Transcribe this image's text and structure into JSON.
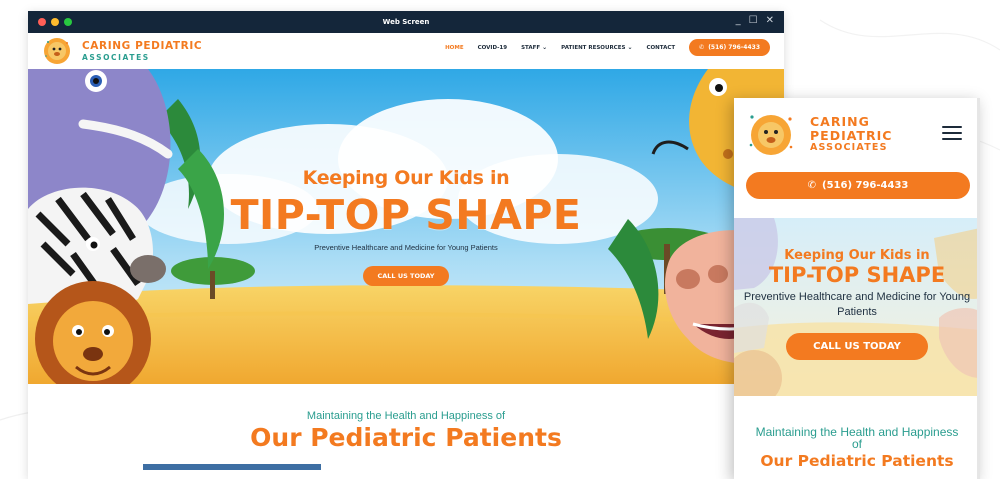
{
  "desktop": {
    "window_title": "Web Screen",
    "window_controls": [
      "_",
      "☐",
      "✕"
    ],
    "brand": {
      "line1": "CARING PEDIATRIC",
      "line2": "ASSOCIATES"
    },
    "nav": [
      {
        "label": "HOME",
        "active": true
      },
      {
        "label": "COVID-19"
      },
      {
        "label": "STAFF",
        "dropdown": true
      },
      {
        "label": "PATIENT RESOURCES",
        "dropdown": true
      },
      {
        "label": "CONTACT"
      }
    ],
    "phone_button": "(516) 796-4433",
    "hero": {
      "subtitle": "Keeping Our Kids in",
      "title": "TIP-TOP SHAPE",
      "description": "Preventive Healthcare and Medicine for Young Patients",
      "cta": "CALL US TODAY"
    },
    "section": {
      "kicker": "Maintaining the Health and Happiness of",
      "title": "Our Pediatric Patients"
    }
  },
  "mobile": {
    "brand": {
      "line1": "CARING",
      "line2": "PEDIATRIC",
      "line3": "ASSOCIATES"
    },
    "phone_button": "(516) 796-4433",
    "hero": {
      "subtitle": "Keeping Our Kids in",
      "title": "TIP-TOP SHAPE",
      "description": "Preventive Healthcare and Medicine for Young Patients",
      "cta": "CALL US TODAY"
    },
    "section": {
      "kicker": "Maintaining the Health and Happiness of",
      "title": "Our Pediatric Patients"
    }
  },
  "icons": {
    "phone": "phone-icon",
    "menu": "hamburger-menu-icon",
    "chevron": "chevron-down-icon",
    "logo": "lion-logo-icon"
  },
  "colors": {
    "accent": "#f37a20",
    "teal": "#2a9d8f",
    "titlebar": "#14263a",
    "dark_text": "#1d2b3a"
  }
}
